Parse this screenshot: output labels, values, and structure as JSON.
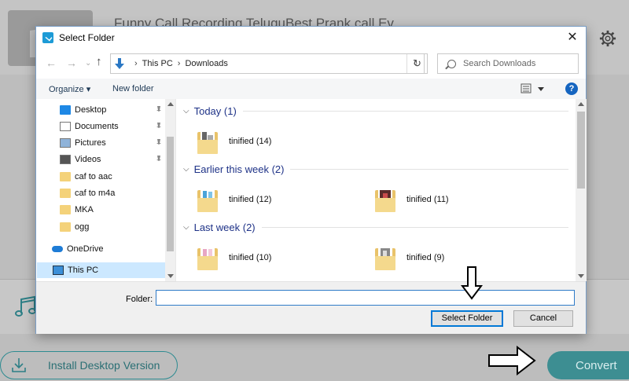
{
  "background_app": {
    "track_title": "Funny Call Recording TeluguBest Prank call Ev",
    "install_button_label": "Install Desktop Version",
    "convert_button_label": "Convert"
  },
  "dialog": {
    "title": "Select Folder",
    "address": {
      "root": "This PC",
      "folder": "Downloads"
    },
    "search_placeholder": "Search Downloads",
    "toolbar": {
      "organize_label": "Organize ▾",
      "new_folder_label": "New folder",
      "help_label": "?"
    },
    "nav_items": [
      {
        "label": "Desktop",
        "icon": "desktop-icon",
        "pinned": true
      },
      {
        "label": "Documents",
        "icon": "documents-icon",
        "pinned": true
      },
      {
        "label": "Pictures",
        "icon": "pictures-icon",
        "pinned": true
      },
      {
        "label": "Videos",
        "icon": "videos-icon",
        "pinned": true
      },
      {
        "label": "caf to aac",
        "icon": "folder-icon",
        "pinned": false
      },
      {
        "label": "caf to m4a",
        "icon": "folder-icon",
        "pinned": false
      },
      {
        "label": "MKA",
        "icon": "folder-icon",
        "pinned": false
      },
      {
        "label": "ogg",
        "icon": "folder-icon",
        "pinned": false
      },
      {
        "label": "OneDrive",
        "icon": "onedrive-icon",
        "pinned": false
      },
      {
        "label": "This PC",
        "icon": "this-pc-icon",
        "pinned": false,
        "selected": true
      }
    ],
    "groups": [
      {
        "header": "Today (1)",
        "items": [
          "tinified (14)"
        ]
      },
      {
        "header": "Earlier this week (2)",
        "items": [
          "tinified (12)",
          "tinified (11)"
        ]
      },
      {
        "header": "Last week (2)",
        "items": [
          "tinified (10)",
          "tinified (9)"
        ]
      }
    ],
    "footer": {
      "folder_label": "Folder:",
      "folder_value": "",
      "select_button_label": "Select Folder",
      "cancel_button_label": "Cancel"
    }
  },
  "colors": {
    "accent": "#0078d7",
    "app_teal": "#3d8e92",
    "group_header": "#1e3287"
  }
}
